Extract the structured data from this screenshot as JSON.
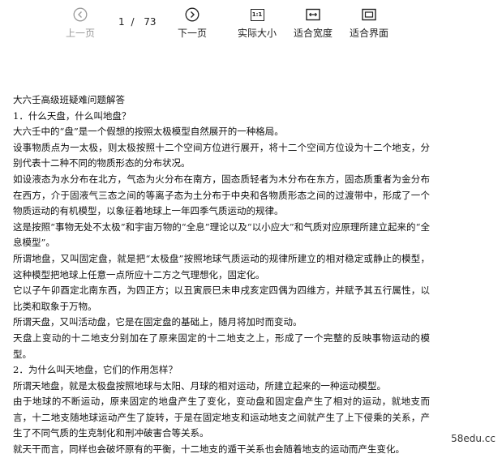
{
  "toolbar": {
    "prev_label": "上一页",
    "current_page": "1",
    "separator": "/",
    "total_pages": "73",
    "next_label": "下一页",
    "actual_size_label": "实际大小",
    "actual_size_icon_text": "1:1",
    "fit_width_label": "适合宽度",
    "fit_page_label": "适合界面"
  },
  "document": {
    "lines": [
      "大六壬高级班疑难问题解答",
      "1．什么天盘，什么叫地盘？",
      "大六壬中的“盘”是一个假想的按照太极模型自然展开的一种格局。",
      "设事物质点为一太极，则太极按照十二个空间方位进行展开，将十二个空间方位设为十二个地支，分别代表十二种不同的物质形态的分布状况。",
      "如设液态为水分布在北方，气态为火分布在南方，固态质轻者为木分布在东方，固态质重者为金分布在西方，介于固液气三态之间的等离子态为土分布于中央和各物质形态之间的过渡带中，形成了一个物质运动的有机模型，以象征着地球上一年四季气质运动的规律。",
      "这是按照“事物无处不太极”和宇宙万物的“全息”理论以及“以小应大”和气质对应原理所建立起来的“全息模型”。",
      "所谓地盘，又叫固定盘，就是把“太极盘”按照地球气质运动的规律所建立的相对稳定或静止的模型，这种模型把地球上任意一点所应十二方之气理想化，固定化。",
      "它以子午卯酉定北南东西，为四正方；以丑寅辰巳未申戌亥定四偶为四维方，并赋予其五行属性，以比类和取象于万物。",
      "所谓天盘，又叫活动盘，它是在固定盘的基础上，随月将加时而变动。",
      "天盘上变动的十二地支分别加在了原来固定的十二地支之上，形成了一个完整的反映事物运动的模型。",
      "2．为什么叫天地盘，它们的作用怎样？",
      "所谓天地盘，就是太极盘按照地球与太阳、月球的相对运动，所建立起来的一种运动模型。",
      "由于地球的不断运动，原来固定的地盘产生了变化，变动盘和固定盘产生了相对的运动，就地支而言，十二地支随地球运动产生了旋转，于是在固定地支和运动地支之间就产生了上下侵乘的关系，产生了不同气质的生克制化和刑冲破害合等关系。",
      "就天干而言，同样也会破坏原有的平衡，十二地支的遁干关系也会随着地支的运动而产生变化。"
    ]
  },
  "watermark": "58edu.cc",
  "colors": {
    "toolbar_icon": "#222222",
    "disabled": "#9a9a9a",
    "text": "#111111"
  },
  "icons": {
    "prev": "chevron-left-circle-icon",
    "next": "chevron-right-circle-icon",
    "actual_size": "one-to-one-icon",
    "fit_width": "fit-width-icon",
    "fit_page": "fit-page-icon"
  }
}
